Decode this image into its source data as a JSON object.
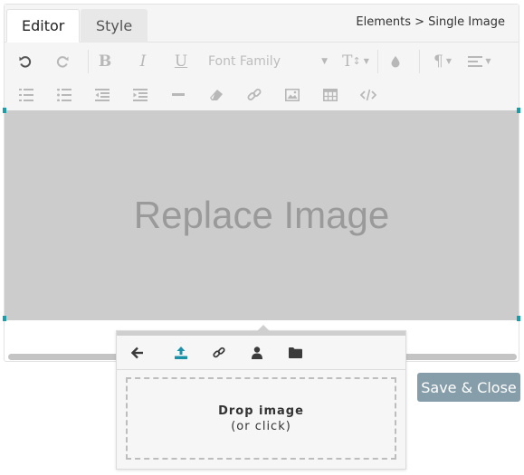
{
  "tabs": [
    {
      "label": "Editor",
      "active": true
    },
    {
      "label": "Style",
      "active": false
    }
  ],
  "breadcrumb": "Elements > Single Image",
  "toolbar": {
    "font_family_label": "Font Family",
    "row1_icons": [
      "undo-icon",
      "redo-icon",
      "bold-icon",
      "italic-icon",
      "underline-icon",
      "font-family-select",
      "font-size-icon",
      "text-color-icon",
      "paragraph-format-icon",
      "align-icon"
    ],
    "row2_icons": [
      "ordered-list-icon",
      "unordered-list-icon",
      "outdent-icon",
      "indent-icon",
      "horizontal-line-icon",
      "clear-formatting-icon",
      "link-icon",
      "image-icon",
      "table-icon",
      "code-view-icon"
    ],
    "glyphs": {
      "bold": "B",
      "italic": "I",
      "underline": "U",
      "paragraph": "¶",
      "font_size": "T"
    }
  },
  "canvas": {
    "placeholder": "Replace Image",
    "background_color": "#cccccc",
    "handle_color": "#1a9fa8"
  },
  "save_button": {
    "label": "Save & Close",
    "color": "#869eaa"
  },
  "image_popup": {
    "buttons": [
      "back-icon",
      "upload-icon",
      "url-link-icon",
      "user-icon",
      "folder-icon"
    ],
    "active_button": "upload-icon",
    "drop_title": "Drop image",
    "drop_subtitle": "(or click)"
  }
}
